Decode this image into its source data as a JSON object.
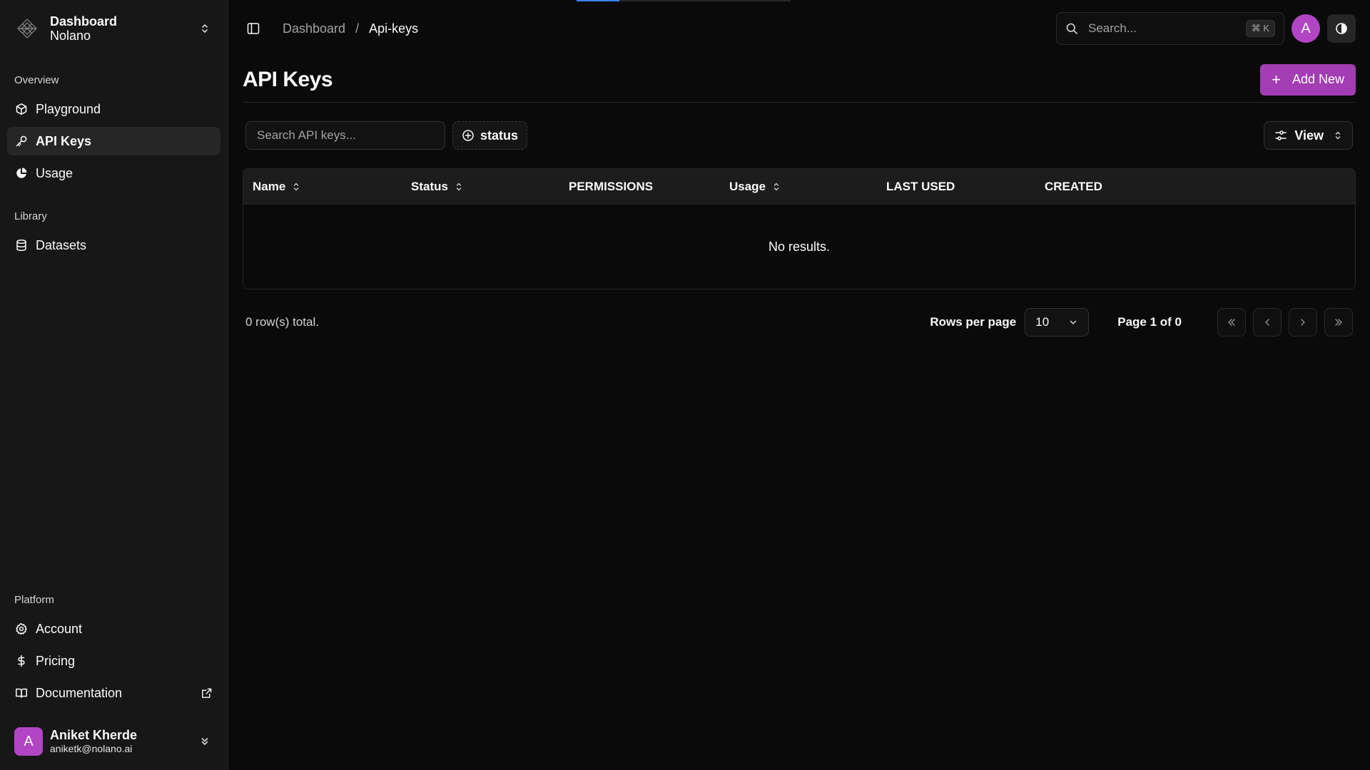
{
  "sidebar": {
    "brand_title": "Dashboard",
    "brand_subtitle": "Nolano",
    "groups": {
      "overview": {
        "label": "Overview",
        "items": [
          {
            "label": "Playground",
            "icon": "cube-icon"
          },
          {
            "label": "API Keys",
            "icon": "key-icon",
            "active": true
          },
          {
            "label": "Usage",
            "icon": "pie-chart-icon"
          }
        ]
      },
      "library": {
        "label": "Library",
        "items": [
          {
            "label": "Datasets",
            "icon": "database-icon"
          }
        ]
      },
      "platform": {
        "label": "Platform",
        "items": [
          {
            "label": "Account",
            "icon": "gear-icon"
          },
          {
            "label": "Pricing",
            "icon": "dollar-icon"
          },
          {
            "label": "Documentation",
            "icon": "book-icon",
            "external": true
          }
        ]
      }
    },
    "user": {
      "initial": "A",
      "name": "Aniket Kherde",
      "email": "aniketk@nolano.ai"
    }
  },
  "header": {
    "breadcrumb": [
      "Dashboard",
      "Api-keys"
    ],
    "breadcrumb_separator": "/",
    "search_placeholder": "Search...",
    "search_shortcut": "⌘ K",
    "avatar_initial": "A"
  },
  "page": {
    "title": "API Keys",
    "add_button_label": "Add New",
    "filter_placeholder": "Search API keys...",
    "status_filter_label": "status",
    "view_button_label": "View"
  },
  "table": {
    "columns": [
      {
        "label": "Name",
        "sortable": true
      },
      {
        "label": "Status",
        "sortable": true
      },
      {
        "label": "PERMISSIONS",
        "sortable": false
      },
      {
        "label": "Usage",
        "sortable": true
      },
      {
        "label": "LAST USED",
        "sortable": false
      },
      {
        "label": "CREATED",
        "sortable": false
      }
    ],
    "empty_message": "No results."
  },
  "pagination": {
    "total_text": "0 row(s) total.",
    "rows_per_page_label": "Rows per page",
    "rows_per_page_value": "10",
    "page_text": "Page 1 of 0"
  },
  "colors": {
    "accent": "#a23db3",
    "avatar": "#b245c4",
    "background": "#0a0a0a",
    "sidebar": "#171717",
    "progress": "#3b82f6"
  }
}
